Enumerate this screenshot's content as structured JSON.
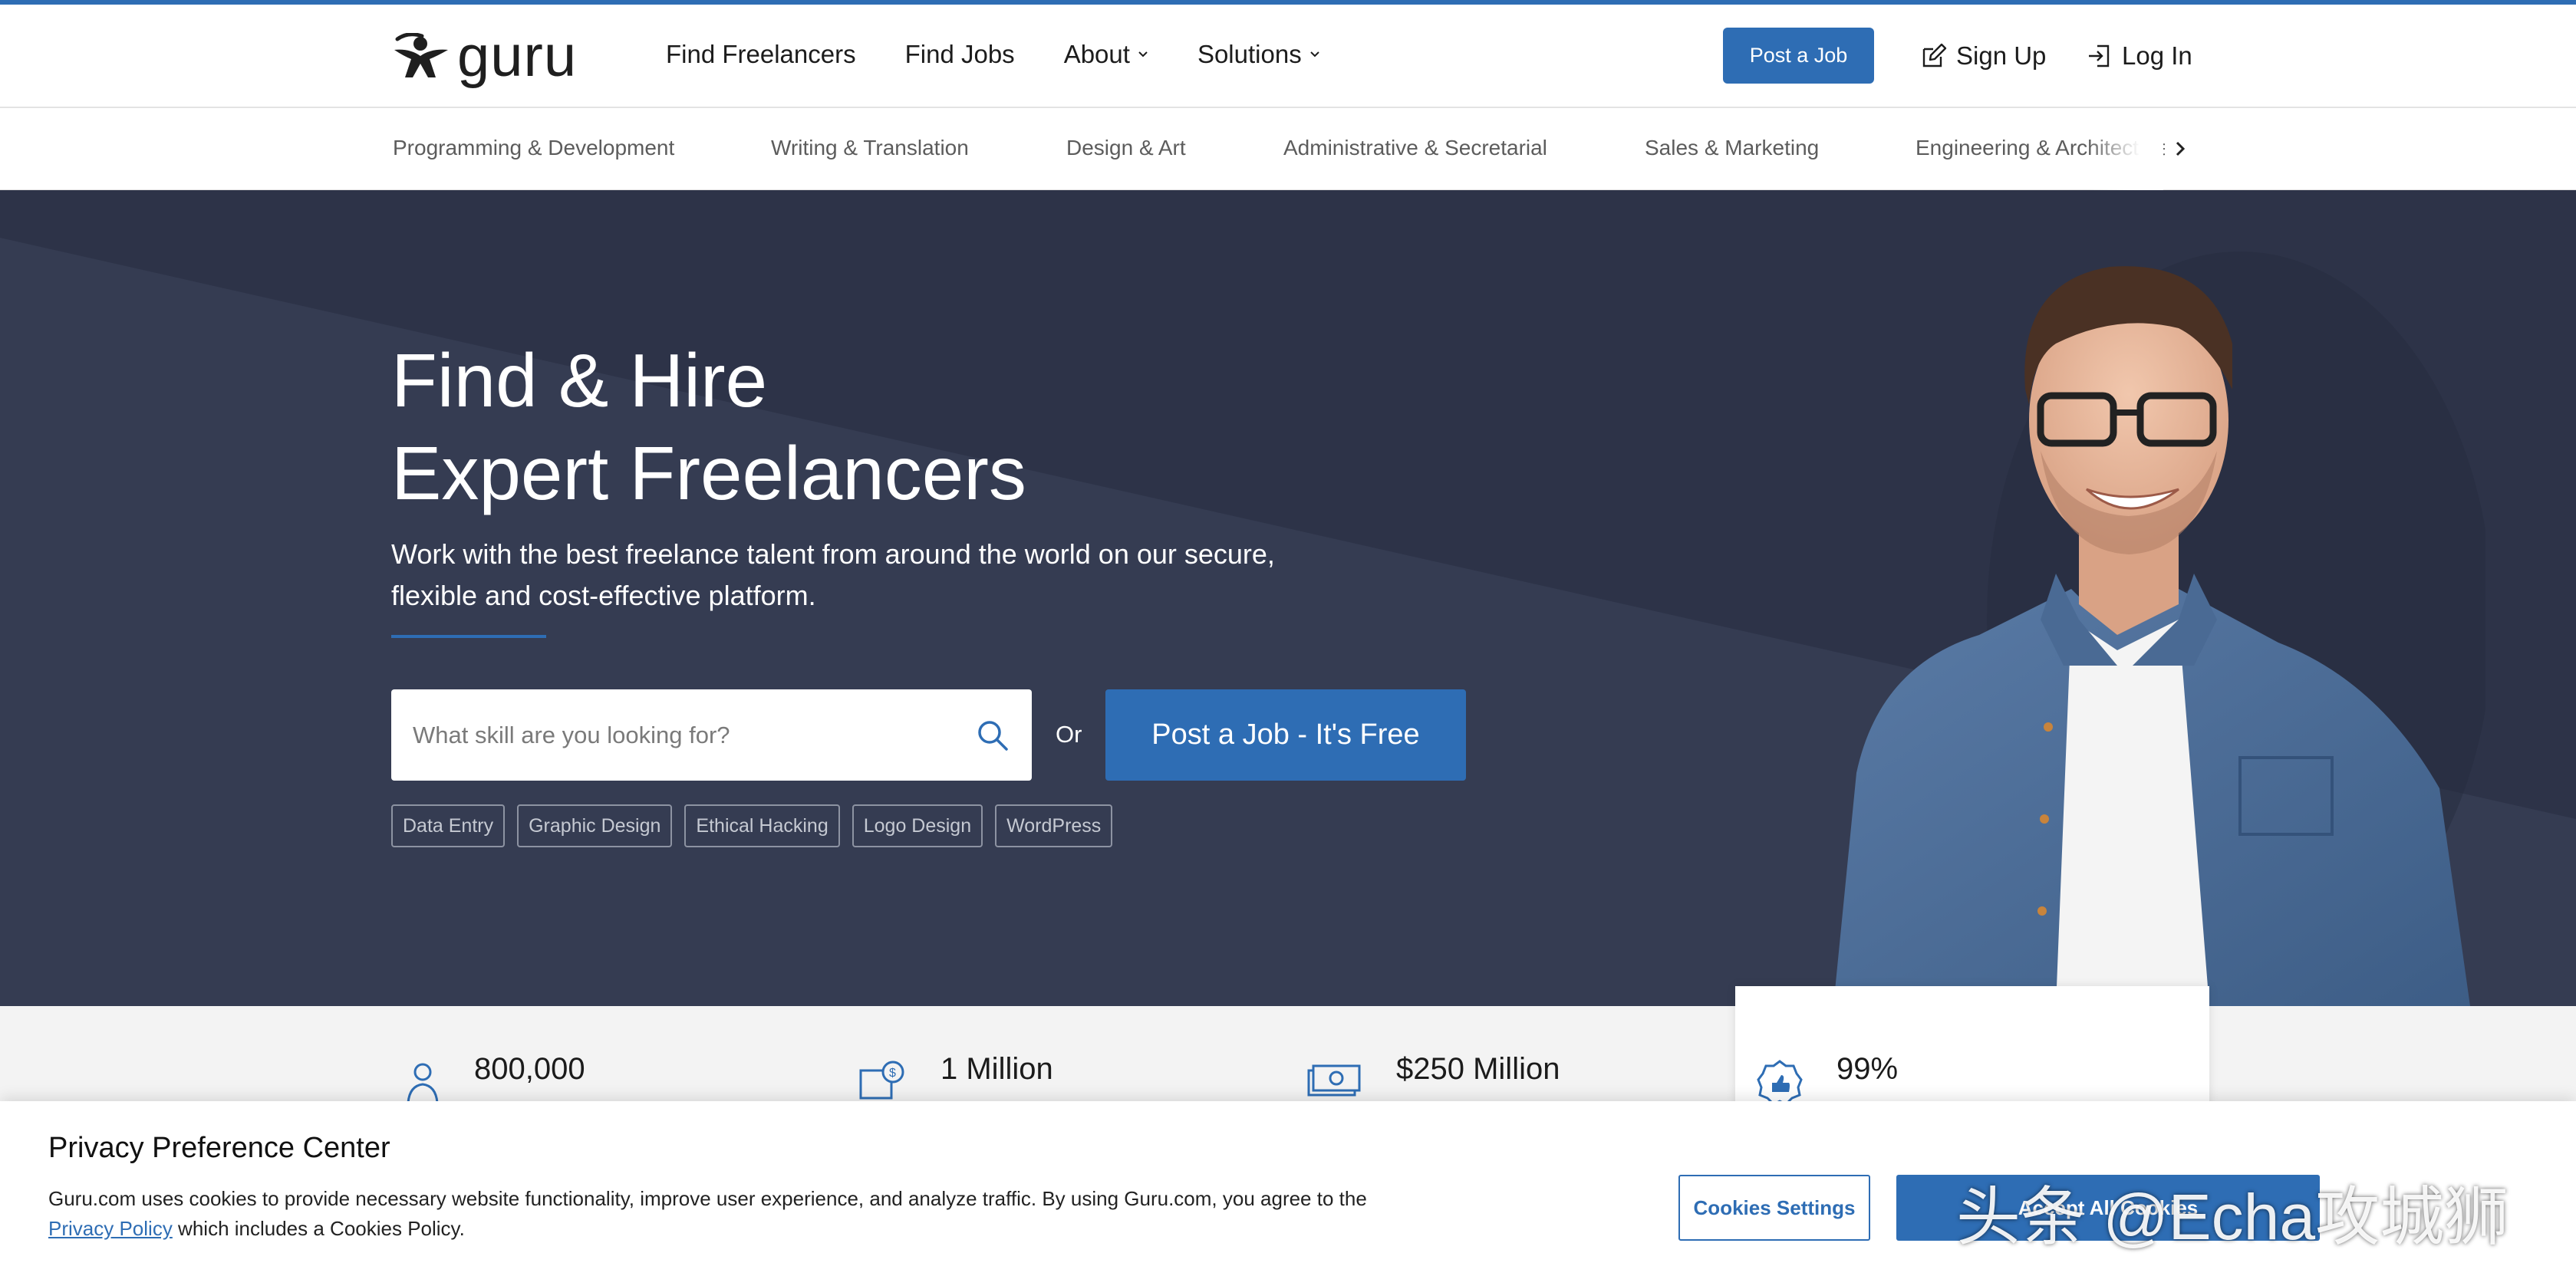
{
  "header": {
    "logo_text": "guru",
    "nav": [
      {
        "label": "Find Freelancers",
        "dropdown": false
      },
      {
        "label": "Find Jobs",
        "dropdown": false
      },
      {
        "label": "About",
        "dropdown": true
      },
      {
        "label": "Solutions",
        "dropdown": true
      }
    ],
    "post_job_label": "Post a Job",
    "signup_label": "Sign Up",
    "login_label": "Log In"
  },
  "categories": [
    "Programming & Development",
    "Writing & Translation",
    "Design & Art",
    "Administrative & Secretarial",
    "Sales & Marketing",
    "Engineering & Architecture"
  ],
  "hero": {
    "title_line1": "Find & Hire",
    "title_line2": "Expert Freelancers",
    "subtitle": "Work with the best freelance talent from around the world on our secure, flexible and cost-effective platform.",
    "search_placeholder": "What skill are you looking for?",
    "or_label": "Or",
    "post_job_label": "Post a Job - It's Free",
    "tags": [
      "Data Entry",
      "Graphic Design",
      "Ethical Hacking",
      "Logo Design",
      "WordPress"
    ]
  },
  "stats": [
    {
      "value": "800,000",
      "icon": "freelancer-icon"
    },
    {
      "value": "1 Million",
      "icon": "invoice-icon"
    },
    {
      "value": "$250 Million",
      "icon": "money-icon"
    },
    {
      "value": "99%",
      "icon": "thumbs-up-badge-icon"
    }
  ],
  "cookie": {
    "title": "Privacy Preference Center",
    "text_before_link": "Guru.com uses cookies to provide necessary website functionality, improve user experience, and analyze traffic. By using Guru.com, you agree to the ",
    "link_label": "Privacy Policy",
    "text_after_link": " which includes a Cookies Policy.",
    "settings_label": "Cookies Settings",
    "accept_label": "Accept All Cookies"
  },
  "watermark": "头条 @Echa攻城狮",
  "colors": {
    "brand_blue": "#2e6db4",
    "hero_bg": "#2d3348",
    "hero_shape": "#353c52"
  }
}
